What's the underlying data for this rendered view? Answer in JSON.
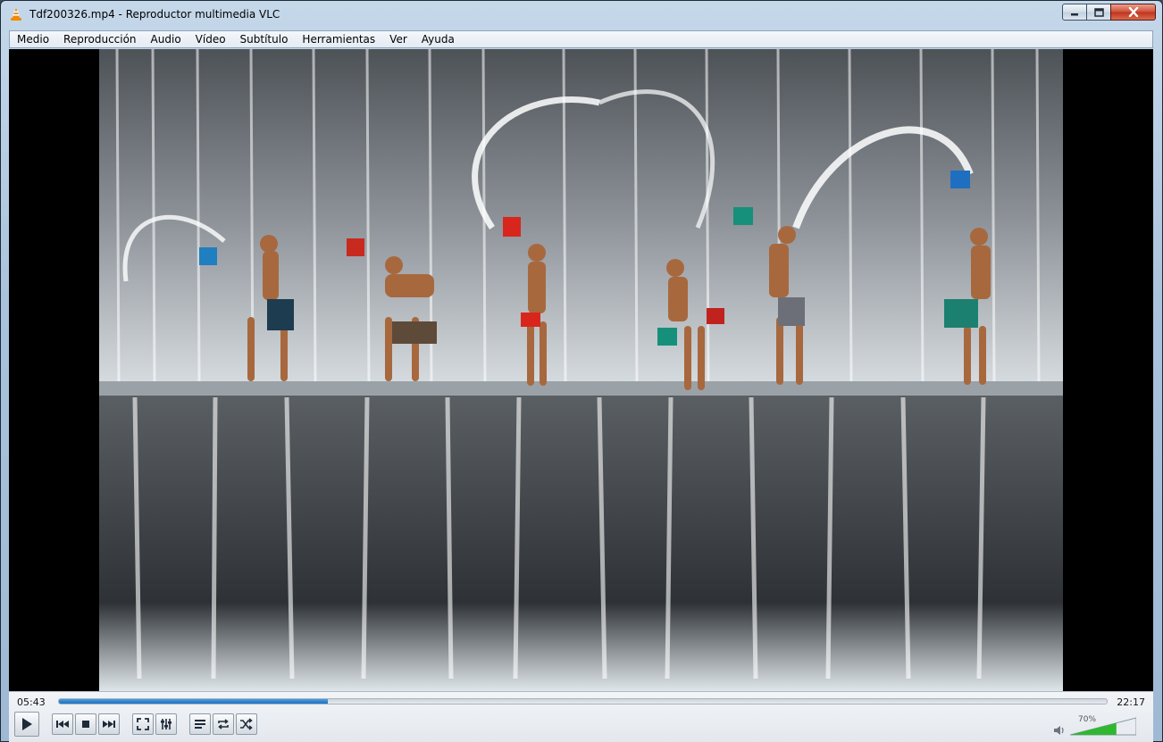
{
  "window": {
    "title": "Tdf200326.mp4 - Reproductor multimedia VLC",
    "app_icon": "vlc-cone-icon",
    "buttons": [
      "minimize-icon",
      "maximize-icon",
      "close-icon"
    ]
  },
  "menu": {
    "items": [
      {
        "label": "Medio"
      },
      {
        "label": "Reproducción"
      },
      {
        "label": "Audio"
      },
      {
        "label": "Vídeo"
      },
      {
        "label": "Subtítulo"
      },
      {
        "label": "Herramientas"
      },
      {
        "label": "Ver"
      },
      {
        "label": "Ayuda"
      }
    ]
  },
  "player": {
    "elapsed": "05:43",
    "total": "22:17",
    "progress_fraction": 0.257,
    "volume_label": "70%",
    "volume_fraction": 0.7,
    "accent_color": "#1d6fc2",
    "volume_color": "#2fb82f"
  },
  "controls": {
    "buttons": [
      {
        "name": "play-button",
        "icon": "play-icon"
      },
      {
        "name": "previous-button",
        "icon": "previous-icon"
      },
      {
        "name": "stop-button",
        "icon": "stop-icon"
      },
      {
        "name": "next-button",
        "icon": "next-icon"
      },
      {
        "name": "fullscreen-button",
        "icon": "fullscreen-icon"
      },
      {
        "name": "extended-settings-button",
        "icon": "equalizer-icon"
      },
      {
        "name": "playlist-button",
        "icon": "playlist-icon"
      },
      {
        "name": "loop-button",
        "icon": "loop-icon"
      },
      {
        "name": "shuffle-button",
        "icon": "shuffle-icon"
      }
    ]
  }
}
